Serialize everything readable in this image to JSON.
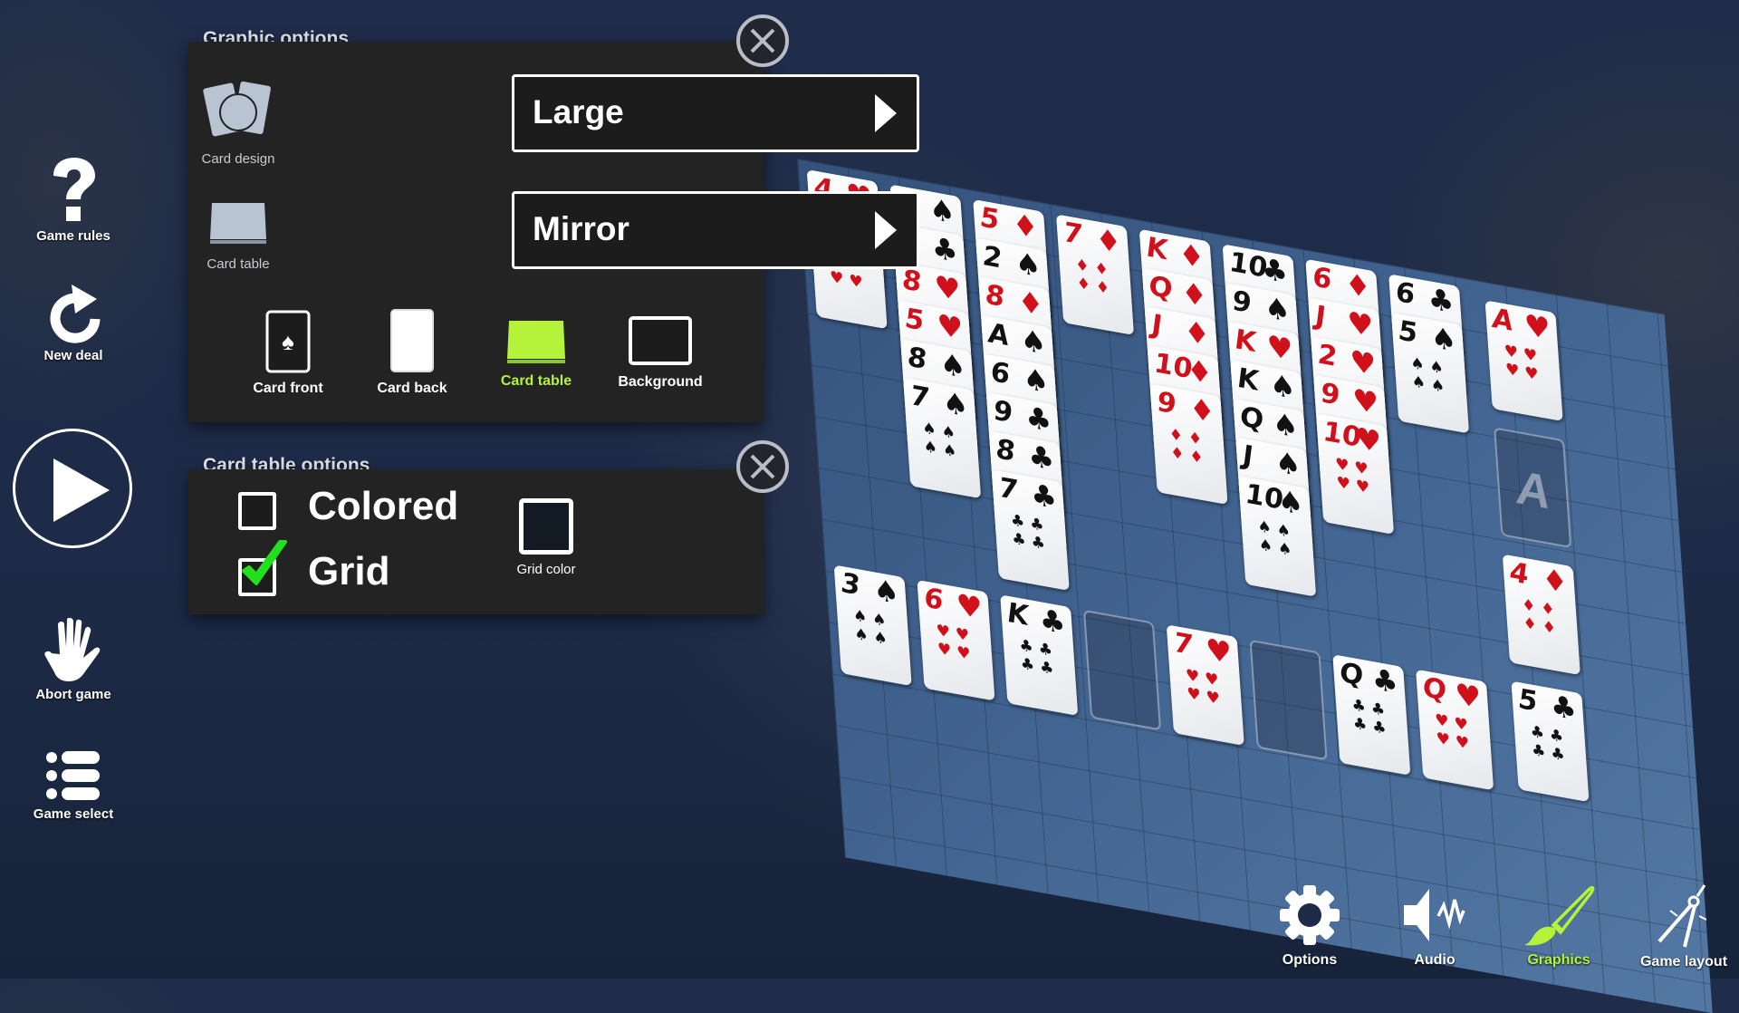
{
  "sidebar": {
    "game_rules": "Game rules",
    "new_deal": "New deal",
    "play": "play",
    "abort_game": "Abort game",
    "game_select": "Game select"
  },
  "graphic_options": {
    "title": "Graphic options",
    "card_design_label": "Card design",
    "card_design_value": "Large",
    "card_table_label": "Card table",
    "card_table_value": "Mirror",
    "tabs": [
      {
        "label": "Card front",
        "active": false
      },
      {
        "label": "Card back",
        "active": false
      },
      {
        "label": "Card table",
        "active": true
      },
      {
        "label": "Background",
        "active": false
      }
    ]
  },
  "card_table_options": {
    "title": "Card table options",
    "colored": {
      "label": "Colored",
      "checked": false
    },
    "grid": {
      "label": "Grid",
      "checked": true
    },
    "grid_color_label": "Grid color",
    "grid_color": "#121a24"
  },
  "toolbar": {
    "items": [
      {
        "label": "Options",
        "active": false
      },
      {
        "label": "Audio",
        "active": false
      },
      {
        "label": "Graphics",
        "active": true
      },
      {
        "label": "Game layout",
        "active": false
      }
    ]
  },
  "colors": {
    "accent": "#b5f23a",
    "check": "#22e01e",
    "panel": "#232323"
  },
  "tableau": {
    "columns": [
      [
        "4♥",
        "3♥"
      ],
      [
        "4♠",
        "J♣",
        "8♥",
        "5♥",
        "8♠",
        "7♠"
      ],
      [
        "5♦",
        "2♠",
        "8♦",
        "A♠",
        "6♠",
        "9♣",
        "8♣",
        "7♣"
      ],
      [
        "7♦"
      ],
      [
        "K♦",
        "Q♦",
        "J♦",
        "10♦",
        "9♦"
      ],
      [
        "10♣",
        "9♠",
        "K♥",
        "K♠",
        "Q♠",
        "J♠",
        "10♠"
      ],
      [
        "6♦",
        "J♥",
        "2♥",
        "9♥",
        "10♥"
      ],
      [
        "6♣",
        "5♠"
      ]
    ],
    "foundations": [
      "A♥",
      "",
      "4♦",
      "5♣"
    ],
    "foundation_placeholder": "A",
    "reserve": [
      "3♠",
      "6♥",
      "K♣",
      "",
      "7♥",
      "",
      "Q♣",
      "Q♥"
    ]
  }
}
